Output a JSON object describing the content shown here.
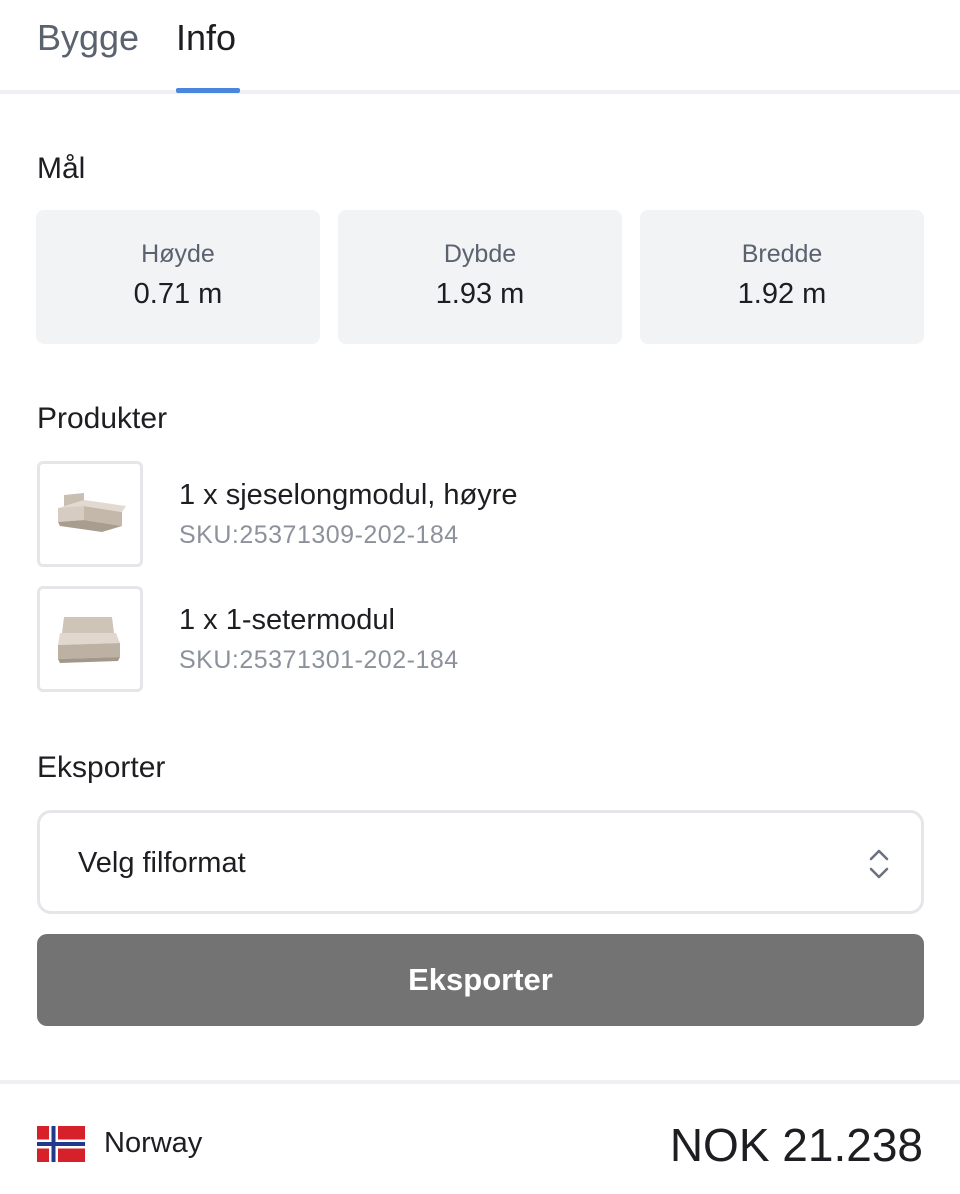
{
  "tabs": {
    "build_label": "Bygge",
    "info_label": "Info",
    "active": "Info"
  },
  "dimensions": {
    "title": "Mål",
    "height_label": "Høyde",
    "height_value": "0.71 m",
    "depth_label": "Dybde",
    "depth_value": "1.93 m",
    "width_label": "Bredde",
    "width_value": "1.92 m"
  },
  "products": {
    "title": "Produkter",
    "items": [
      {
        "name": "1 x sjeselongmodul, høyre",
        "sku": "SKU:25371309-202-184",
        "icon": "chaise-module-icon"
      },
      {
        "name": "1 x 1-setermodul",
        "sku": "SKU:25371301-202-184",
        "icon": "one-seater-module-icon"
      }
    ]
  },
  "export": {
    "title": "Eksporter",
    "select_placeholder": "Velg filformat",
    "button_label": "Eksporter"
  },
  "footer": {
    "country": "Norway",
    "price": "NOK 21.238"
  },
  "colors": {
    "accent": "#4a86e0",
    "button_bg": "#737373",
    "card_bg": "#f2f3f5",
    "flag_red": "#d6202a",
    "flag_blue": "#1f3a8a"
  }
}
